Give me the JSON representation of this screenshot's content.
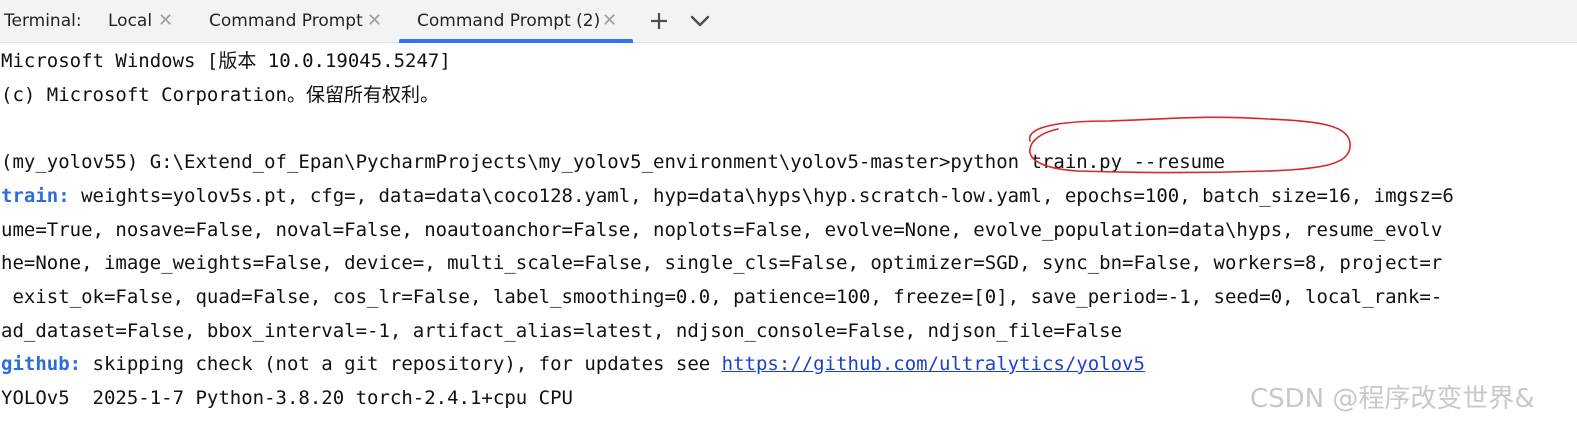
{
  "tabbar": {
    "label": "Terminal:",
    "tabs": [
      {
        "label": "Local"
      },
      {
        "label": "Command Prompt"
      },
      {
        "label": "Command Prompt (2)",
        "active": true
      }
    ],
    "add_icon": "plus-icon",
    "dropdown_icon": "chevron-down-icon",
    "accent": "#3574f0"
  },
  "terminal": {
    "lines": [
      "Microsoft Windows [版本 10.0.19045.5247]",
      "(c) Microsoft Corporation。保留所有权利。",
      "",
      "(my_yolov55) G:\\Extend_of_Epan\\PycharmProjects\\my_yolov5_environment\\yolov5-master>python train.py --resume",
      " weights=yolov5s.pt, cfg=, data=data\\coco128.yaml, hyp=data\\hyps\\hyp.scratch-low.yaml, epochs=100, batch_size=16, imgsz=6",
      "ume=True, nosave=False, noval=False, noautoanchor=False, noplots=False, evolve=None, evolve_population=data\\hyps, resume_evolv",
      "he=None, image_weights=False, device=, multi_scale=False, single_cls=False, optimizer=SGD, sync_bn=False, workers=8, project=r",
      " exist_ok=False, quad=False, cos_lr=False, label_smoothing=0.0, patience=100, freeze=[0], save_period=-1, seed=0, local_rank=-",
      "ad_dataset=False, bbox_interval=-1, artifact_alias=latest, ndjson_console=False, ndjson_file=False",
      " skipping check (not a git repository), for updates see ",
      "YOLOv5  2025-1-7 Python-3.8.20 torch-2.4.1+cpu CPU"
    ],
    "train_label": "train:",
    "github_label": "github:",
    "github_url": "https://github.com/ultralytics/yolov5",
    "keyword_color": "#2d6cdf",
    "annotation_color": "#d9262c"
  },
  "watermark": "CSDN @程序改变世界&"
}
